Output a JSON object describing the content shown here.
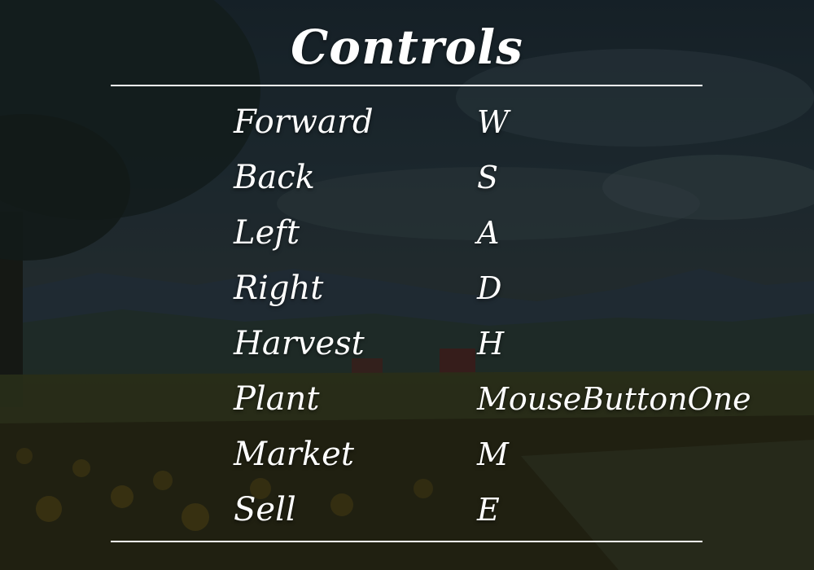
{
  "title": "Controls",
  "controls": [
    {
      "action": "Forward",
      "key": "W"
    },
    {
      "action": "Back",
      "key": "S"
    },
    {
      "action": "Left",
      "key": "A"
    },
    {
      "action": "Right",
      "key": "D"
    },
    {
      "action": "Harvest",
      "key": "H"
    },
    {
      "action": "Plant",
      "key": "MouseButtonOne"
    },
    {
      "action": "Market",
      "key": "M"
    },
    {
      "action": "Sell",
      "key": "E"
    }
  ]
}
